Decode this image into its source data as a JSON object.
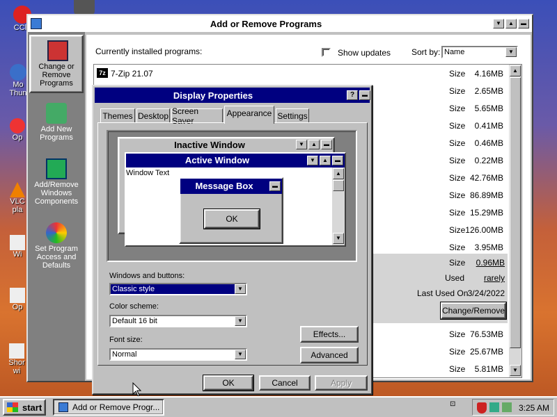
{
  "desktop": {
    "icons": [
      "CCle",
      "Mo Thun",
      "Op",
      "VLC pla",
      "Wi",
      "Op",
      "Shor wi"
    ]
  },
  "arp": {
    "title": "Add or Remove Programs",
    "sidebar": [
      {
        "label": "Change or Remove Programs"
      },
      {
        "label": "Add New Programs"
      },
      {
        "label": "Add/Remove Windows Components"
      },
      {
        "label": "Set Program Access and Defaults"
      }
    ],
    "installed_label": "Currently installed programs:",
    "show_updates": "Show updates",
    "sort_by_label": "Sort by:",
    "sort_by_value": "Name",
    "first_program": "7-Zip 21.07",
    "size_label": "Size",
    "sizes": [
      "4.16MB",
      "2.65MB",
      "5.65MB",
      "0.41MB",
      "0.46MB",
      "0.22MB",
      "42.76MB",
      "86.89MB",
      "15.29MB",
      "126.00MB",
      "3.95MB"
    ],
    "selected": {
      "size": "0.96MB",
      "used_label": "Used",
      "used_value": "rarely",
      "last_used_label": "Last Used On",
      "last_used_value": "3/24/2022",
      "change_remove": "Change/Remove"
    },
    "sizes_after": [
      "76.53MB",
      "25.67MB",
      "5.81MB"
    ]
  },
  "dp": {
    "title": "Display Properties",
    "tabs": [
      "Themes",
      "Desktop",
      "Screen Saver",
      "Appearance",
      "Settings"
    ],
    "preview": {
      "inactive": "Inactive Window",
      "active": "Active Window",
      "window_text": "Window Text",
      "message_box": "Message Box",
      "ok": "OK"
    },
    "windows_buttons_label": "Windows and buttons:",
    "windows_buttons_value": "Classic style",
    "color_scheme_label": "Color scheme:",
    "color_scheme_value": "Default 16 bit",
    "font_size_label": "Font size:",
    "font_size_value": "Normal",
    "effects": "Effects...",
    "advanced": "Advanced",
    "ok": "OK",
    "cancel": "Cancel",
    "apply": "Apply"
  },
  "taskbar": {
    "start": "start",
    "task": "Add or Remove Progr...",
    "time": "3:25 AM"
  }
}
